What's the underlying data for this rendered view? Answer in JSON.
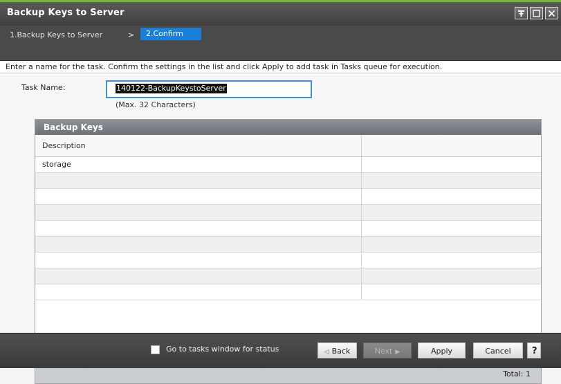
{
  "window": {
    "title": "Backup Keys to Server",
    "controls": [
      "pin-icon",
      "maximize-icon",
      "close-icon"
    ]
  },
  "wizard": {
    "step1": "1.Backup Keys to Server",
    "separator": ">",
    "step2": "2.Confirm"
  },
  "instruction": "Enter a name for the task. Confirm the settings in the list and click Apply to add task in Tasks queue for execution.",
  "task": {
    "label": "Task Name:",
    "value": "140122-BackupKeystoServer",
    "hint": "(Max. 32 Characters)"
  },
  "panel": {
    "title": "Backup Keys",
    "columns": [
      "Description",
      ""
    ],
    "rows": [
      [
        "storage",
        ""
      ],
      [
        "",
        ""
      ],
      [
        "",
        ""
      ],
      [
        "",
        ""
      ],
      [
        "",
        ""
      ],
      [
        "",
        ""
      ],
      [
        "",
        ""
      ],
      [
        "",
        ""
      ],
      [
        "",
        ""
      ]
    ],
    "total": "Total:  1"
  },
  "footer": {
    "checkbox_label": "Go to tasks window for status",
    "back": "Back",
    "next": "Next",
    "apply": "Apply",
    "cancel": "Cancel",
    "help": "?"
  },
  "colors": {
    "accent": "#1a7fd9",
    "top_line": "#74b83e"
  }
}
